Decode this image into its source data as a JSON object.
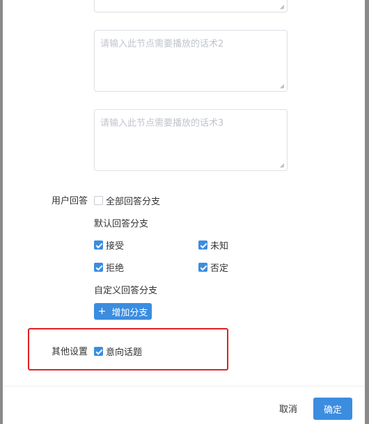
{
  "textareas": [
    {
      "placeholder": ""
    },
    {
      "placeholder": "请输入此节点需要播放的话术2"
    },
    {
      "placeholder": "请输入此节点需要播放的话术3"
    }
  ],
  "user_answer": {
    "label": "用户回答",
    "all_branches": {
      "label": "全部回答分支",
      "checked": false
    },
    "default_title": "默认回答分支",
    "options": [
      {
        "label": "接受",
        "checked": true
      },
      {
        "label": "未知",
        "checked": true
      },
      {
        "label": "拒绝",
        "checked": true
      },
      {
        "label": "否定",
        "checked": true
      }
    ],
    "custom_title": "自定义回答分支",
    "add_button": "增加分支"
  },
  "other_settings": {
    "label": "其他设置",
    "intent_topic": {
      "label": "意向话题",
      "checked": true
    }
  },
  "footer": {
    "cancel": "取消",
    "confirm": "确定"
  }
}
